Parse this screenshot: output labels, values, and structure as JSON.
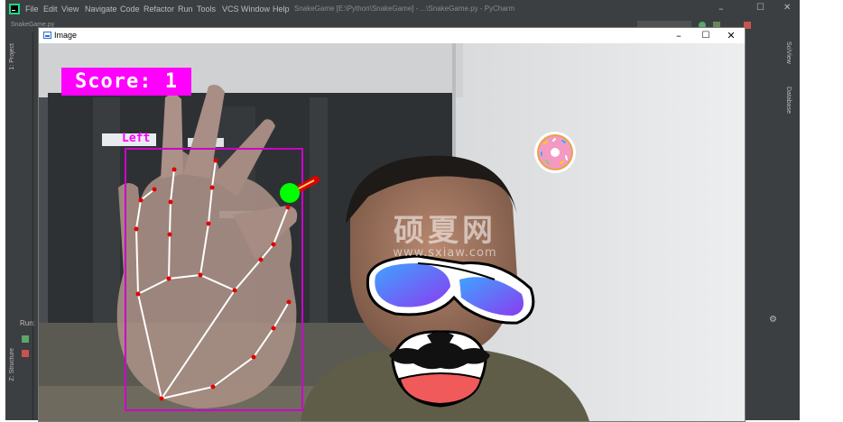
{
  "ide": {
    "menu": [
      "File",
      "Edit",
      "View",
      "Navigate",
      "Code",
      "Refactor",
      "Run",
      "Tools",
      "VCS",
      "Window",
      "Help"
    ],
    "title": "SnakeGame [E:\\Python\\SnakeGame] - ...\\SnakeGame.py - PyCharm",
    "nav_tab": "SnakeGame.py",
    "left_tabs": [
      "1: Project",
      "Z: Structure"
    ],
    "right_tabs": [
      "SciView",
      "Database"
    ],
    "run_label": "Run:"
  },
  "window": {
    "title": "Image",
    "controls": [
      "–",
      "☐",
      "✕"
    ]
  },
  "overlay": {
    "score": "Score: 1",
    "hand_label": "Left"
  },
  "watermark": {
    "title": "硕夏网",
    "url": "www.sxiaw.com"
  },
  "colors": {
    "score_bg": "#ff00ff",
    "bbox": "#cc00cc",
    "landmark": "#e00000",
    "connector": "#ffffff",
    "snake_head": "#00ff00",
    "snake_body": "#dd0000",
    "food": "#f49ac2"
  },
  "icons": [
    "pycharm-icon",
    "image-window-icon",
    "donut-icon",
    "sunglasses-icon",
    "mustache-icon"
  ]
}
